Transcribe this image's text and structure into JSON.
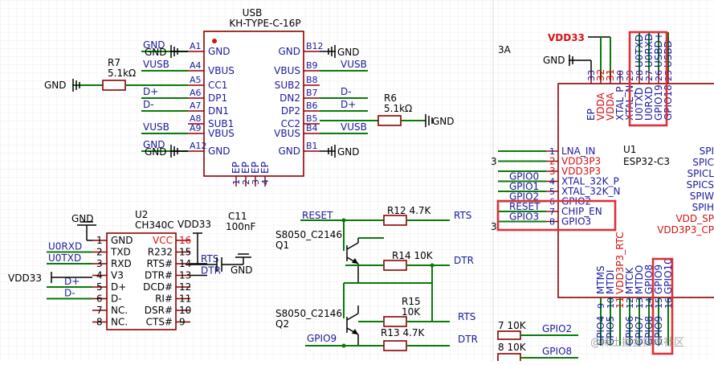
{
  "usb": {
    "title": "USB",
    "part": "KH-TYPE-C-16P",
    "left_pins": [
      {
        "num": "A1",
        "name": "GND",
        "net": "GND"
      },
      {
        "num": "A4",
        "name": "VBUS",
        "net": "VUSB"
      },
      {
        "num": "A5",
        "name": "CC1",
        "net": ""
      },
      {
        "num": "A6",
        "name": "DP1",
        "net": "D+"
      },
      {
        "num": "A7",
        "name": "DN1",
        "net": "D-"
      },
      {
        "num": "A8",
        "name": "SUB1",
        "net": ""
      },
      {
        "num": "A9",
        "name": "VBUS",
        "net": "VUSB"
      },
      {
        "num": "A12",
        "name": "GND",
        "net": "GND"
      }
    ],
    "right_pins": [
      {
        "num": "B12",
        "name": "GND",
        "net": "GND"
      },
      {
        "num": "B9",
        "name": "VBUS",
        "net": "VUSB"
      },
      {
        "num": "B8",
        "name": "SUB2",
        "net": ""
      },
      {
        "num": "B7",
        "name": "DN2",
        "net": "D-"
      },
      {
        "num": "B6",
        "name": "DP2",
        "net": "D+"
      },
      {
        "num": "B5",
        "name": "CC2",
        "net": ""
      },
      {
        "num": "B4",
        "name": "VBUS",
        "net": "VUSB"
      },
      {
        "num": "B1",
        "name": "GND",
        "net": "GND"
      }
    ],
    "ep_labels": [
      "EP",
      "EP",
      "EP",
      "EP"
    ],
    "ep_nums": [
      "1",
      "2",
      "3",
      "4"
    ]
  },
  "r7": {
    "ref": "R7",
    "value": "5.1kΩ"
  },
  "r6": {
    "ref": "R6",
    "value": "5.1kΩ"
  },
  "gnd": "GND",
  "u2": {
    "ref": "U2",
    "part": "CH340C",
    "left_pins": [
      {
        "num": "1",
        "name": "GND",
        "net": ""
      },
      {
        "num": "2",
        "name": "TXD",
        "net": "U0RXD"
      },
      {
        "num": "3",
        "name": "RXD",
        "net": "U0TXD"
      },
      {
        "num": "4",
        "name": "V3",
        "net": "VDD33"
      },
      {
        "num": "5",
        "name": "D+",
        "net": "D+"
      },
      {
        "num": "6",
        "name": "D-",
        "net": "D-"
      },
      {
        "num": "7",
        "name": "NC.",
        "net": ""
      },
      {
        "num": "8",
        "name": "NC.",
        "net": ""
      }
    ],
    "right_pins": [
      {
        "num": "16",
        "name": "VCC",
        "net": "VDD33"
      },
      {
        "num": "15",
        "name": "R232",
        "net": ""
      },
      {
        "num": "14",
        "name": "RTS#",
        "net": "RTS"
      },
      {
        "num": "13",
        "name": "DTR#",
        "net": "DTR"
      },
      {
        "num": "12",
        "name": "DCD#",
        "net": ""
      },
      {
        "num": "11",
        "name": "RI#",
        "net": ""
      },
      {
        "num": "10",
        "name": "DSR#",
        "net": ""
      },
      {
        "num": "9",
        "name": "CTS#",
        "net": ""
      }
    ]
  },
  "c11": {
    "ref": "C11",
    "value": "100nF"
  },
  "vdd33": "VDD33",
  "transistors": [
    {
      "model": "S8050_C2146",
      "ref": "Q1"
    },
    {
      "model": "S8050_C2146",
      "ref": "Q2"
    }
  ],
  "auto_reset": {
    "reset": "RESET",
    "gpio9": "GPIO9",
    "rts": "RTS",
    "dtr": "DTR",
    "r12": {
      "ref": "R12",
      "value": "4.7K"
    },
    "r14": {
      "ref": "R14",
      "value": "10K"
    },
    "r15": {
      "ref": "R15",
      "value": "10K"
    },
    "r13": {
      "ref": "R13",
      "value": "4.7K"
    }
  },
  "esp": {
    "partial_ref": "3A",
    "vdd33": "VDD33",
    "gnd": "GND",
    "ref": "U1",
    "part": "ESP32-C3",
    "top_pins": [
      {
        "num": "33",
        "name": "EP",
        "color": "navy"
      },
      {
        "num": "32",
        "name": "VDDA",
        "color": "red"
      },
      {
        "num": "31",
        "name": "VDDA",
        "color": "red"
      },
      {
        "num": "30",
        "name": "XTAL_P",
        "color": "navy"
      },
      {
        "num": "29",
        "name": "XTAL_N",
        "color": "navy"
      },
      {
        "num": "28",
        "name": "U0TXD",
        "color": "navy"
      },
      {
        "num": "27",
        "name": "U0RXD",
        "color": "navy"
      },
      {
        "num": "26",
        "name": "GPIO19",
        "color": "navy"
      },
      {
        "num": "25",
        "name": "GPIO18",
        "color": "navy"
      }
    ],
    "top_nets": [
      "U0TXD",
      "U0RXD",
      "USBD+",
      "USBD-"
    ],
    "left_pins": [
      {
        "num": "1",
        "name": "LNA_IN",
        "color": "navy",
        "net": ""
      },
      {
        "num": "2",
        "name": "VDD3P3",
        "color": "red",
        "net": ""
      },
      {
        "num": "3",
        "name": "VDD3P3",
        "color": "red",
        "net": ""
      },
      {
        "num": "4",
        "name": "XTAL_32K_P",
        "color": "navy",
        "net": "GPIO0"
      },
      {
        "num": "5",
        "name": "XTAL_32K_N",
        "color": "navy",
        "net": "GPIO1"
      },
      {
        "num": "6",
        "name": "GPIO2",
        "color": "navy",
        "net": "GPIO2"
      },
      {
        "num": "7",
        "name": "CHIP_EN",
        "color": "navy",
        "net": "RESET"
      },
      {
        "num": "8",
        "name": "GPIO3",
        "color": "navy",
        "net": "GPIO3"
      }
    ],
    "left_partial": [
      "3",
      "3"
    ],
    "right_names": [
      {
        "name": "SPI",
        "color": "navy"
      },
      {
        "name": "SPIC",
        "color": "navy"
      },
      {
        "name": "SPICL",
        "color": "navy"
      },
      {
        "name": "SPICS",
        "color": "navy"
      },
      {
        "name": "SPIW",
        "color": "navy"
      },
      {
        "name": "SPIH",
        "color": "navy"
      },
      {
        "name": "VDD_SP",
        "color": "red"
      },
      {
        "name": "VDD3P3_CP",
        "color": "red"
      }
    ],
    "bottom_pins": [
      {
        "num": "9",
        "name": "MTMS",
        "color": "navy"
      },
      {
        "num": "10",
        "name": "MTDI",
        "color": "navy"
      },
      {
        "num": "11",
        "name": "VDD3P3_RTC",
        "color": "red"
      },
      {
        "num": "12",
        "name": "MTCK",
        "color": "navy"
      },
      {
        "num": "13",
        "name": "MTDO",
        "color": "navy"
      },
      {
        "num": "14",
        "name": "GPIO8",
        "color": "navy"
      },
      {
        "num": "15",
        "name": "GPIO9",
        "color": "navy"
      },
      {
        "num": "16",
        "name": "GPIO10",
        "color": "navy"
      }
    ],
    "bottom_nets": [
      "GPIO4",
      "GPIO5",
      "",
      "GPIO6",
      "GPIO7",
      "GPIO8",
      "GPIO9"
    ],
    "res_rows": [
      {
        "ref": "7",
        "value": "10K",
        "net": "GPIO2"
      },
      {
        "ref": "8",
        "value": "10K",
        "net": "GPIO8"
      }
    ]
  },
  "watermark": "@稀土掘金技术社区"
}
